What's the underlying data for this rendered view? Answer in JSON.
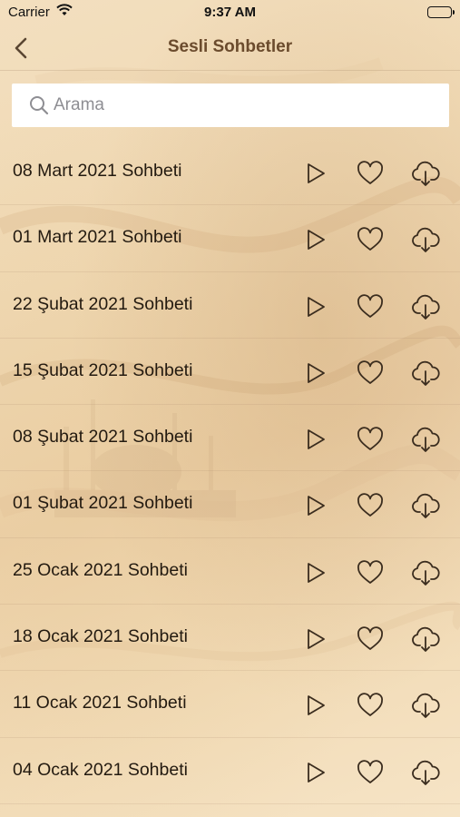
{
  "status_bar": {
    "carrier": "Carrier",
    "time": "9:37 AM"
  },
  "nav": {
    "title": "Sesli Sohbetler",
    "back_icon": "chevron-left-icon"
  },
  "search": {
    "placeholder": "Arama",
    "value": ""
  },
  "items": [
    {
      "label": "08 Mart 2021 Sohbeti"
    },
    {
      "label": "01 Mart 2021 Sohbeti"
    },
    {
      "label": "22 Şubat 2021 Sohbeti"
    },
    {
      "label": "15 Şubat 2021 Sohbeti"
    },
    {
      "label": "08 Şubat 2021 Sohbeti"
    },
    {
      "label": "01 Şubat 2021 Sohbeti"
    },
    {
      "label": "25 Ocak 2021 Sohbeti"
    },
    {
      "label": "18 Ocak 2021 Sohbeti"
    },
    {
      "label": "11 Ocak 2021 Sohbeti"
    },
    {
      "label": "04 Ocak 2021 Sohbeti"
    }
  ],
  "row_icons": [
    "play-icon",
    "heart-icon",
    "cloud-download-icon"
  ],
  "colors": {
    "title": "#6b4b2d",
    "icon": "#3a2c1e",
    "search_bg": "#ffffff"
  }
}
